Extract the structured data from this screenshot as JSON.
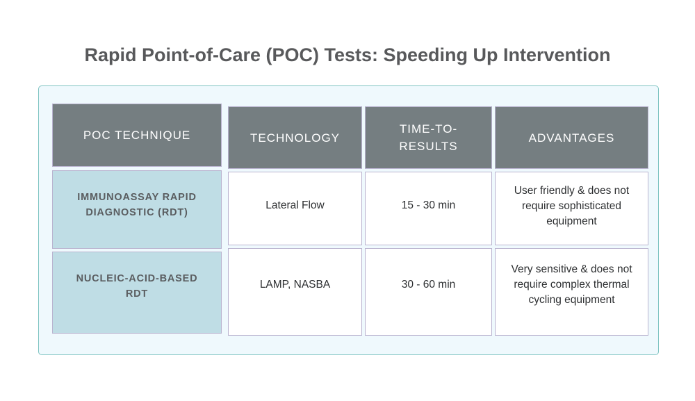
{
  "title": "Rapid Point-of-Care (POC) Tests: Speeding Up Intervention",
  "table": {
    "headers": [
      "POC TECHNIQUE",
      "TECHNOLOGY",
      "TIME-TO-RESULTS",
      "ADVANTAGES"
    ],
    "rows": [
      {
        "technique": "IMMUNOASSAY RAPID DIAGNOSTIC (RDT)",
        "technology": "Lateral Flow",
        "time_to_results": "15 - 30 min",
        "advantages": "User friendly & does not require sophisticated equipment"
      },
      {
        "technique": "NUCLEIC-ACID-BASED RDT",
        "technology": "LAMP, NASBA",
        "time_to_results": "30 - 60 min",
        "advantages": "Very sensitive & does not require complex thermal cycling equipment"
      }
    ]
  },
  "colors": {
    "header_bg": "#757e81",
    "row_header_bg": "#bfdde5",
    "panel_bg": "#eff9fd",
    "panel_border": "#7fc4c2",
    "title_text": "#58595b"
  }
}
